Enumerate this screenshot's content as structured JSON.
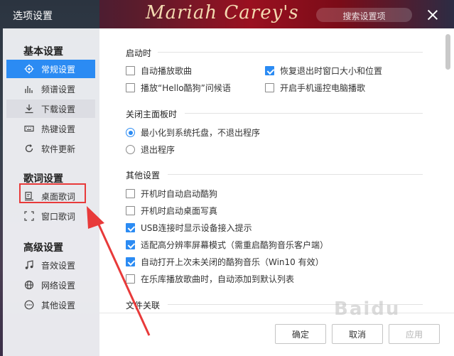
{
  "window": {
    "title": "选项设置",
    "banner_text": "Mariah Carey's",
    "search_placeholder": "搜索设置项"
  },
  "sidebar": {
    "sections": [
      {
        "title": "基本设置",
        "items": [
          {
            "label": "常规设置",
            "icon": "gear-icon",
            "state": "active"
          },
          {
            "label": "频谱设置",
            "icon": "spectrum-icon",
            "state": "normal"
          },
          {
            "label": "下载设置",
            "icon": "download-icon",
            "state": "hover"
          },
          {
            "label": "热键设置",
            "icon": "keyboard-icon",
            "state": "normal"
          },
          {
            "label": "软件更新",
            "icon": "update-icon",
            "state": "normal"
          }
        ]
      },
      {
        "title": "歌词设置",
        "items": [
          {
            "label": "桌面歌词",
            "icon": "desktop-lyrics-icon",
            "state": "highlighted"
          },
          {
            "label": "窗口歌词",
            "icon": "window-lyrics-icon",
            "state": "normal"
          }
        ]
      },
      {
        "title": "高级设置",
        "items": [
          {
            "label": "音效设置",
            "icon": "audio-effect-icon",
            "state": "normal"
          },
          {
            "label": "网络设置",
            "icon": "network-icon",
            "state": "normal"
          },
          {
            "label": "其他设置",
            "icon": "more-icon",
            "state": "normal"
          }
        ]
      }
    ]
  },
  "main": {
    "startup": {
      "title": "启动时",
      "options": [
        {
          "label": "自动播放歌曲",
          "checked": false
        },
        {
          "label": "恢复退出时窗口大小和位置",
          "checked": true
        },
        {
          "label": "播放“Hello酷狗”问候语",
          "checked": false
        },
        {
          "label": "开启手机遥控电脑播歌",
          "checked": false
        }
      ]
    },
    "close_panel": {
      "title": "关闭主面板时",
      "options": [
        {
          "label": "最小化到系统托盘，不退出程序",
          "selected": true
        },
        {
          "label": "退出程序",
          "selected": false
        }
      ]
    },
    "other": {
      "title": "其他设置",
      "options": [
        {
          "label": "开机时自动启动酷狗",
          "checked": false
        },
        {
          "label": "开机时启动桌面写真",
          "checked": false
        },
        {
          "label": "USB连接时显示设备接入提示",
          "checked": true
        },
        {
          "label": "适配高分辨率屏幕模式（需重启酷狗音乐客户端）",
          "checked": true
        },
        {
          "label": "自动打开上次未关闭的酷狗音乐（Win10 有效）",
          "checked": true
        },
        {
          "label": "在乐库播放歌曲时，自动添加到默认列表",
          "checked": false
        }
      ]
    },
    "file_assoc": {
      "title": "文件关联"
    }
  },
  "footer": {
    "ok_label": "确定",
    "cancel_label": "取消",
    "apply_label": "应用"
  },
  "colors": {
    "accent": "#2b8bf3",
    "annotation": "#e83a3a"
  },
  "watermark": "Baidu"
}
